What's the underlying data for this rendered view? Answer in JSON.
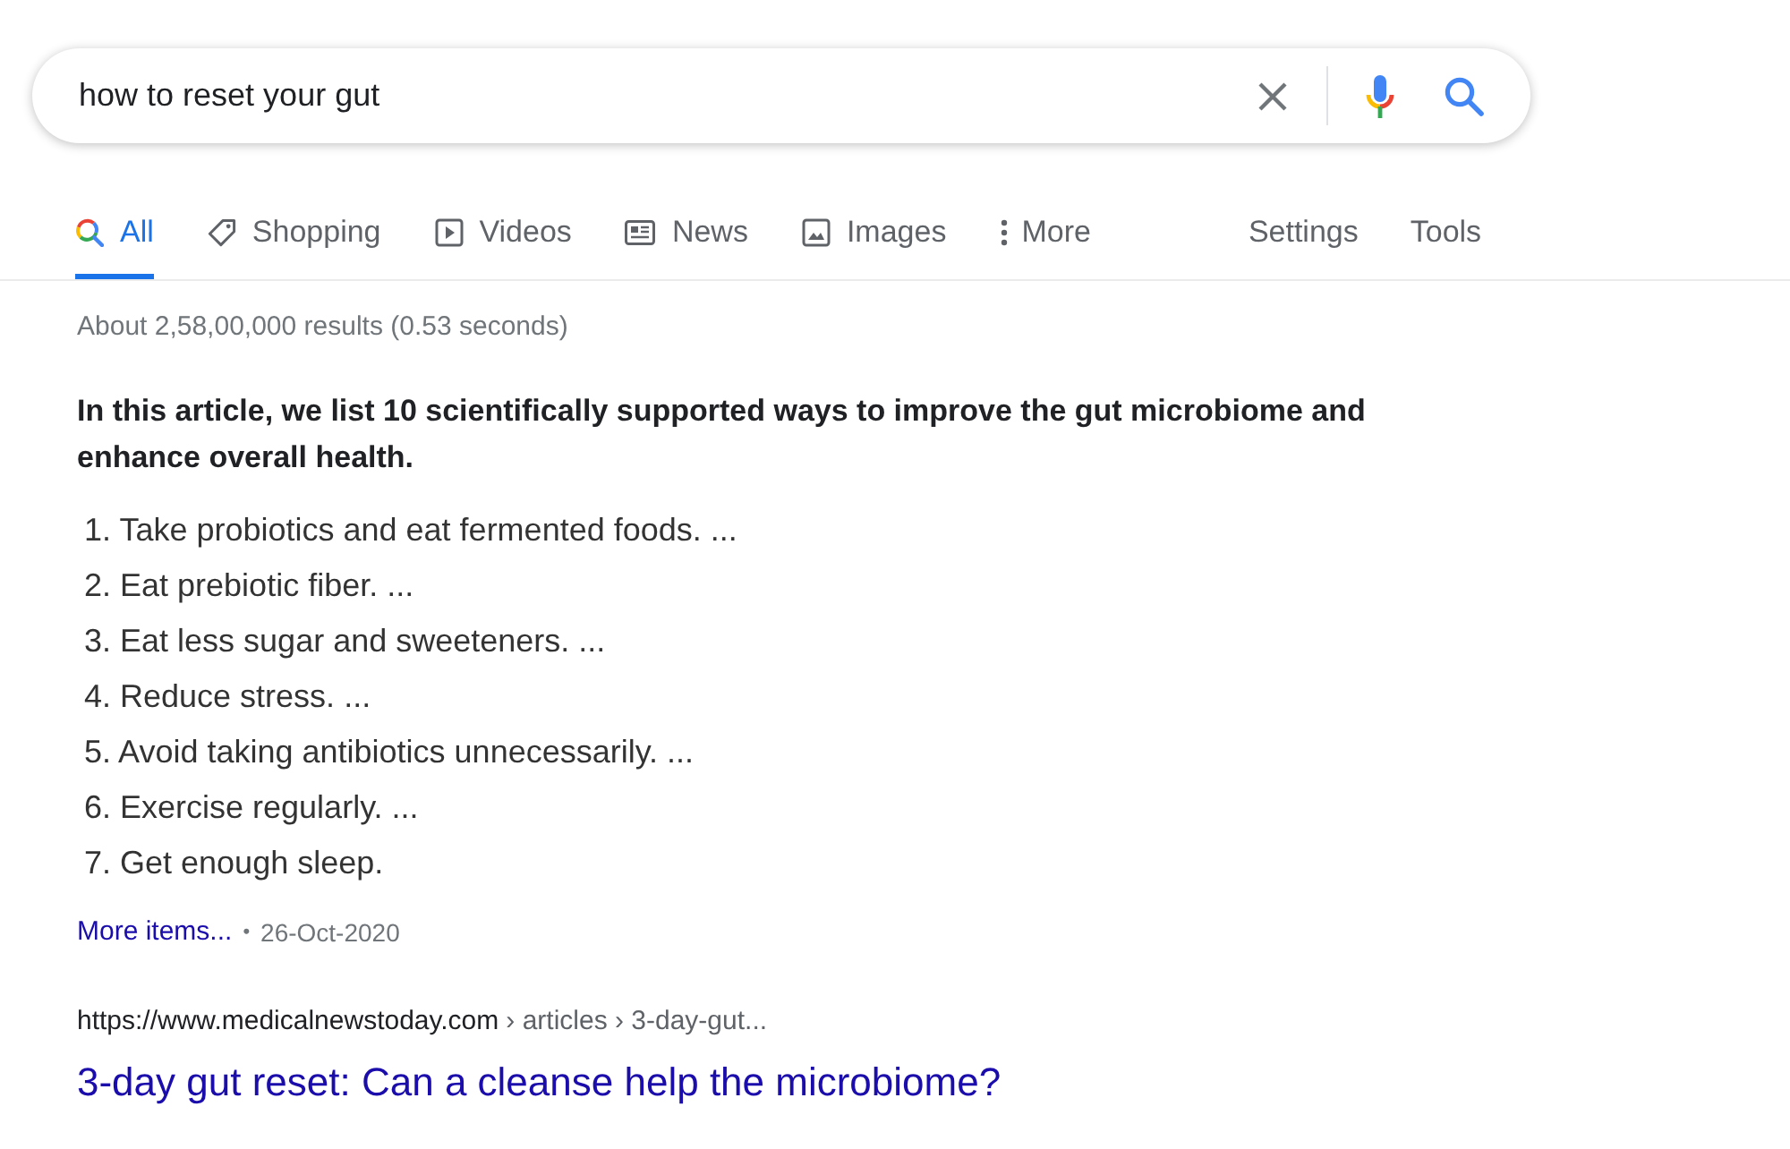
{
  "search": {
    "query": "how to reset your gut"
  },
  "tabs": [
    {
      "kind": "all",
      "label": "All",
      "selected": true
    },
    {
      "kind": "shopping",
      "label": "Shopping",
      "selected": false
    },
    {
      "kind": "videos",
      "label": "Videos",
      "selected": false
    },
    {
      "kind": "news",
      "label": "News",
      "selected": false
    },
    {
      "kind": "images",
      "label": "Images",
      "selected": false
    },
    {
      "kind": "more",
      "label": "More",
      "selected": false
    }
  ],
  "tool_links": [
    "Settings",
    "Tools"
  ],
  "result_stats": "About 2,58,00,000 results (0.53 seconds)",
  "featured_snippet": {
    "heading": "In this article, we list 10 scientifically supported ways to improve the gut microbiome and enhance overall health.",
    "items": [
      "1. Take probiotics and eat fermented foods. ...",
      "2. Eat prebiotic fiber. ...",
      "3. Eat less sugar and sweeteners. ...",
      "4. Reduce stress. ...",
      "5. Avoid taking antibiotics unnecessarily. ...",
      "6. Exercise regularly. ...",
      "7. Get enough sleep."
    ],
    "more_link": "More items...",
    "separator": "•",
    "date": "26-Oct-2020"
  },
  "result": {
    "site": "https://www.medicalnewstoday.com",
    "path": "› articles › 3-day-gut...",
    "title": "3-day gut reset: Can a cleanse help the microbiome?"
  }
}
